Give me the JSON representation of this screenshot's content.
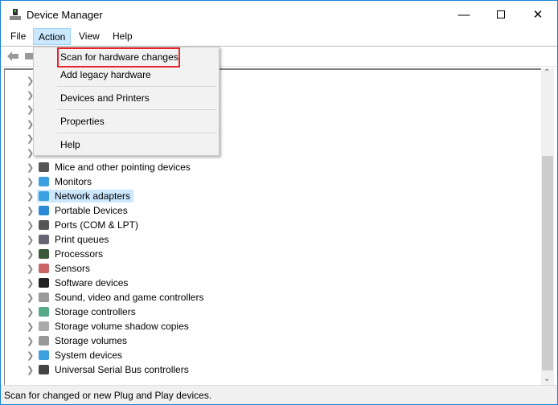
{
  "window": {
    "title": "Device Manager",
    "controls": [
      "minimize",
      "maximize",
      "close"
    ]
  },
  "menubar": [
    {
      "label": "File"
    },
    {
      "label": "Action",
      "active": true
    },
    {
      "label": "View"
    },
    {
      "label": "Help"
    }
  ],
  "action_menu": {
    "items": [
      {
        "label": "Scan for hardware changes",
        "highlighted": true
      },
      {
        "label": "Add legacy hardware"
      },
      {
        "label": "Devices and Printers"
      },
      {
        "label": "Properties"
      },
      {
        "label": "Help"
      }
    ]
  },
  "tree": {
    "items": [
      {
        "label": "Mice and other pointing devices",
        "icon": "mouse-icon"
      },
      {
        "label": "Monitors",
        "icon": "monitor-icon"
      },
      {
        "label": "Network adapters",
        "icon": "network-icon",
        "selected": true
      },
      {
        "label": "Portable Devices",
        "icon": "portable-device-icon"
      },
      {
        "label": "Ports (COM & LPT)",
        "icon": "port-icon"
      },
      {
        "label": "Print queues",
        "icon": "printer-icon"
      },
      {
        "label": "Processors",
        "icon": "processor-icon"
      },
      {
        "label": "Sensors",
        "icon": "sensor-icon"
      },
      {
        "label": "Software devices",
        "icon": "software-device-icon"
      },
      {
        "label": "Sound, video and game controllers",
        "icon": "speaker-icon"
      },
      {
        "label": "Storage controllers",
        "icon": "storage-controller-icon"
      },
      {
        "label": "Storage volume shadow copies",
        "icon": "drive-icon"
      },
      {
        "label": "Storage volumes",
        "icon": "volume-icon"
      },
      {
        "label": "System devices",
        "icon": "system-icon"
      },
      {
        "label": "Universal Serial Bus controllers",
        "icon": "usb-icon"
      }
    ]
  },
  "status": "Scan for changed or new Plug and Play devices.",
  "colors": {
    "highlight_border": "#e8242a",
    "selection": "#cce8ff",
    "window_border": "#1883d7"
  }
}
